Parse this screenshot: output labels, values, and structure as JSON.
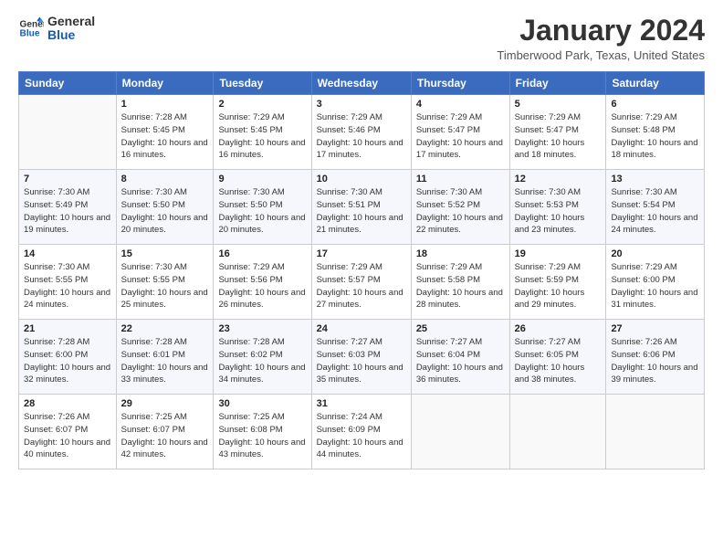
{
  "header": {
    "logo_line1": "General",
    "logo_line2": "Blue",
    "month_title": "January 2024",
    "location": "Timberwood Park, Texas, United States"
  },
  "weekdays": [
    "Sunday",
    "Monday",
    "Tuesday",
    "Wednesday",
    "Thursday",
    "Friday",
    "Saturday"
  ],
  "weeks": [
    [
      {
        "num": "",
        "sunrise": "",
        "sunset": "",
        "daylight": ""
      },
      {
        "num": "1",
        "sunrise": "Sunrise: 7:28 AM",
        "sunset": "Sunset: 5:45 PM",
        "daylight": "Daylight: 10 hours and 16 minutes."
      },
      {
        "num": "2",
        "sunrise": "Sunrise: 7:29 AM",
        "sunset": "Sunset: 5:45 PM",
        "daylight": "Daylight: 10 hours and 16 minutes."
      },
      {
        "num": "3",
        "sunrise": "Sunrise: 7:29 AM",
        "sunset": "Sunset: 5:46 PM",
        "daylight": "Daylight: 10 hours and 17 minutes."
      },
      {
        "num": "4",
        "sunrise": "Sunrise: 7:29 AM",
        "sunset": "Sunset: 5:47 PM",
        "daylight": "Daylight: 10 hours and 17 minutes."
      },
      {
        "num": "5",
        "sunrise": "Sunrise: 7:29 AM",
        "sunset": "Sunset: 5:47 PM",
        "daylight": "Daylight: 10 hours and 18 minutes."
      },
      {
        "num": "6",
        "sunrise": "Sunrise: 7:29 AM",
        "sunset": "Sunset: 5:48 PM",
        "daylight": "Daylight: 10 hours and 18 minutes."
      }
    ],
    [
      {
        "num": "7",
        "sunrise": "Sunrise: 7:30 AM",
        "sunset": "Sunset: 5:49 PM",
        "daylight": "Daylight: 10 hours and 19 minutes."
      },
      {
        "num": "8",
        "sunrise": "Sunrise: 7:30 AM",
        "sunset": "Sunset: 5:50 PM",
        "daylight": "Daylight: 10 hours and 20 minutes."
      },
      {
        "num": "9",
        "sunrise": "Sunrise: 7:30 AM",
        "sunset": "Sunset: 5:50 PM",
        "daylight": "Daylight: 10 hours and 20 minutes."
      },
      {
        "num": "10",
        "sunrise": "Sunrise: 7:30 AM",
        "sunset": "Sunset: 5:51 PM",
        "daylight": "Daylight: 10 hours and 21 minutes."
      },
      {
        "num": "11",
        "sunrise": "Sunrise: 7:30 AM",
        "sunset": "Sunset: 5:52 PM",
        "daylight": "Daylight: 10 hours and 22 minutes."
      },
      {
        "num": "12",
        "sunrise": "Sunrise: 7:30 AM",
        "sunset": "Sunset: 5:53 PM",
        "daylight": "Daylight: 10 hours and 23 minutes."
      },
      {
        "num": "13",
        "sunrise": "Sunrise: 7:30 AM",
        "sunset": "Sunset: 5:54 PM",
        "daylight": "Daylight: 10 hours and 24 minutes."
      }
    ],
    [
      {
        "num": "14",
        "sunrise": "Sunrise: 7:30 AM",
        "sunset": "Sunset: 5:55 PM",
        "daylight": "Daylight: 10 hours and 24 minutes."
      },
      {
        "num": "15",
        "sunrise": "Sunrise: 7:30 AM",
        "sunset": "Sunset: 5:55 PM",
        "daylight": "Daylight: 10 hours and 25 minutes."
      },
      {
        "num": "16",
        "sunrise": "Sunrise: 7:29 AM",
        "sunset": "Sunset: 5:56 PM",
        "daylight": "Daylight: 10 hours and 26 minutes."
      },
      {
        "num": "17",
        "sunrise": "Sunrise: 7:29 AM",
        "sunset": "Sunset: 5:57 PM",
        "daylight": "Daylight: 10 hours and 27 minutes."
      },
      {
        "num": "18",
        "sunrise": "Sunrise: 7:29 AM",
        "sunset": "Sunset: 5:58 PM",
        "daylight": "Daylight: 10 hours and 28 minutes."
      },
      {
        "num": "19",
        "sunrise": "Sunrise: 7:29 AM",
        "sunset": "Sunset: 5:59 PM",
        "daylight": "Daylight: 10 hours and 29 minutes."
      },
      {
        "num": "20",
        "sunrise": "Sunrise: 7:29 AM",
        "sunset": "Sunset: 6:00 PM",
        "daylight": "Daylight: 10 hours and 31 minutes."
      }
    ],
    [
      {
        "num": "21",
        "sunrise": "Sunrise: 7:28 AM",
        "sunset": "Sunset: 6:00 PM",
        "daylight": "Daylight: 10 hours and 32 minutes."
      },
      {
        "num": "22",
        "sunrise": "Sunrise: 7:28 AM",
        "sunset": "Sunset: 6:01 PM",
        "daylight": "Daylight: 10 hours and 33 minutes."
      },
      {
        "num": "23",
        "sunrise": "Sunrise: 7:28 AM",
        "sunset": "Sunset: 6:02 PM",
        "daylight": "Daylight: 10 hours and 34 minutes."
      },
      {
        "num": "24",
        "sunrise": "Sunrise: 7:27 AM",
        "sunset": "Sunset: 6:03 PM",
        "daylight": "Daylight: 10 hours and 35 minutes."
      },
      {
        "num": "25",
        "sunrise": "Sunrise: 7:27 AM",
        "sunset": "Sunset: 6:04 PM",
        "daylight": "Daylight: 10 hours and 36 minutes."
      },
      {
        "num": "26",
        "sunrise": "Sunrise: 7:27 AM",
        "sunset": "Sunset: 6:05 PM",
        "daylight": "Daylight: 10 hours and 38 minutes."
      },
      {
        "num": "27",
        "sunrise": "Sunrise: 7:26 AM",
        "sunset": "Sunset: 6:06 PM",
        "daylight": "Daylight: 10 hours and 39 minutes."
      }
    ],
    [
      {
        "num": "28",
        "sunrise": "Sunrise: 7:26 AM",
        "sunset": "Sunset: 6:07 PM",
        "daylight": "Daylight: 10 hours and 40 minutes."
      },
      {
        "num": "29",
        "sunrise": "Sunrise: 7:25 AM",
        "sunset": "Sunset: 6:07 PM",
        "daylight": "Daylight: 10 hours and 42 minutes."
      },
      {
        "num": "30",
        "sunrise": "Sunrise: 7:25 AM",
        "sunset": "Sunset: 6:08 PM",
        "daylight": "Daylight: 10 hours and 43 minutes."
      },
      {
        "num": "31",
        "sunrise": "Sunrise: 7:24 AM",
        "sunset": "Sunset: 6:09 PM",
        "daylight": "Daylight: 10 hours and 44 minutes."
      },
      {
        "num": "",
        "sunrise": "",
        "sunset": "",
        "daylight": ""
      },
      {
        "num": "",
        "sunrise": "",
        "sunset": "",
        "daylight": ""
      },
      {
        "num": "",
        "sunrise": "",
        "sunset": "",
        "daylight": ""
      }
    ]
  ]
}
